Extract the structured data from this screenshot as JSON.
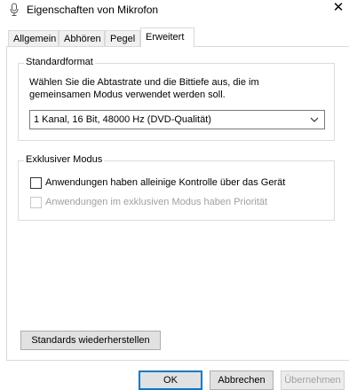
{
  "window": {
    "title": "Eigenschaften von Mikrofon",
    "icon": "microphone-icon",
    "close_glyph": "✕"
  },
  "tabs": [
    {
      "label": "Allgemein",
      "active": false
    },
    {
      "label": "Abhören",
      "active": false
    },
    {
      "label": "Pegel",
      "active": false
    },
    {
      "label": "Erweitert",
      "active": true
    }
  ],
  "standardformat": {
    "legend": "Standardformat",
    "description_line1": "Wählen Sie die Abtastrate und die Bittiefe aus, die im",
    "description_line2": "gemeinsamen Modus verwendet werden soll.",
    "format_select_value": "1 Kanal, 16 Bit, 48000 Hz (DVD-Qualität)"
  },
  "exklusiver_modus": {
    "legend": "Exklusiver Modus",
    "option1_label": "Anwendungen haben alleinige Kontrolle über das Gerät",
    "option1_checked": false,
    "option2_label": "Anwendungen im exklusiven Modus haben Priorität",
    "option2_checked": false,
    "option2_enabled": false
  },
  "buttons": {
    "restore_defaults": "Standards wiederherstellen",
    "ok": "OK",
    "cancel": "Abbrechen",
    "apply": "Übernehmen"
  },
  "colors": {
    "accent": "#0078d7",
    "disabled_text": "#a0a0a0"
  }
}
